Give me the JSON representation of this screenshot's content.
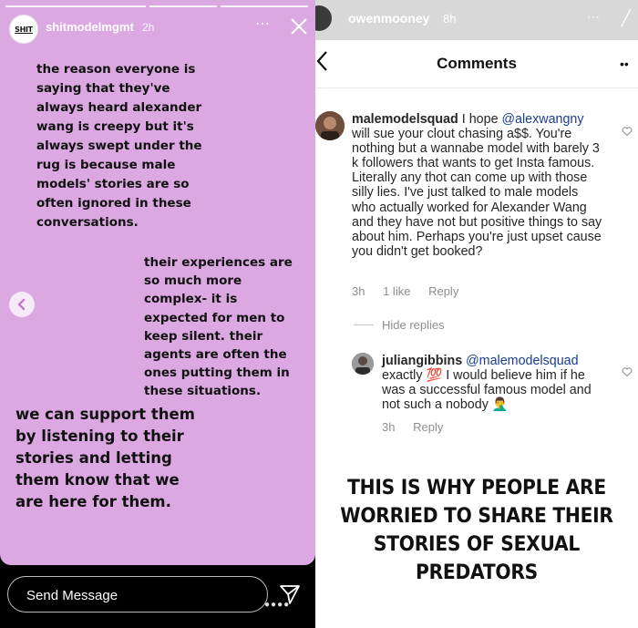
{
  "story": {
    "username": "shitmodelmgmt",
    "time": "2h",
    "avatar_text": "SHIT",
    "more_icon": "⋯",
    "paragraph1": "the reason everyone is saying that they've always heard alexander wang is creepy but it's always swept under the rug is because male models' stories are so often ignored in these conversations.",
    "paragraph2": "their experiences are so much more complex- it is expected for men to keep silent. their agents are often the ones putting them in these situations.",
    "paragraph3": "we can support them by listening to their stories and letting them know that we are here for them.",
    "send_placeholder": "Send Message",
    "background_color": "#dba8e2"
  },
  "comments_view": {
    "top_user": "owenmooney",
    "top_time": "8h",
    "title": "Comments",
    "comment1": {
      "user": "malemodelsquad",
      "mention": "@alexwangny",
      "text_before": "I hope",
      "text_after": "will sue your clout chasing a$$. You're nothing but a wannabe model with barely 3 k followers that wants to get Insta famous. Literally any thot can come up with those silly lies. I've just talked to male models who actually worked for Alexander Wang and they have not but positive things to say about him. Perhaps you're just upset cause you didn't get booked?",
      "time": "3h",
      "likes": "1 like",
      "reply": "Reply"
    },
    "hide_replies": "Hide replies",
    "comment2": {
      "user": "juliangibbins",
      "mention": "@malemodelsquad",
      "text": "exactly 💯 I would believe him if he was a successful famous model and not such a nobody 🤦‍♂️",
      "time": "3h",
      "reply": "Reply"
    },
    "caption": "THIS IS WHY PEOPLE ARE WORRIED TO SHARE THEIR STORIES OF SEXUAL PREDATORS"
  }
}
